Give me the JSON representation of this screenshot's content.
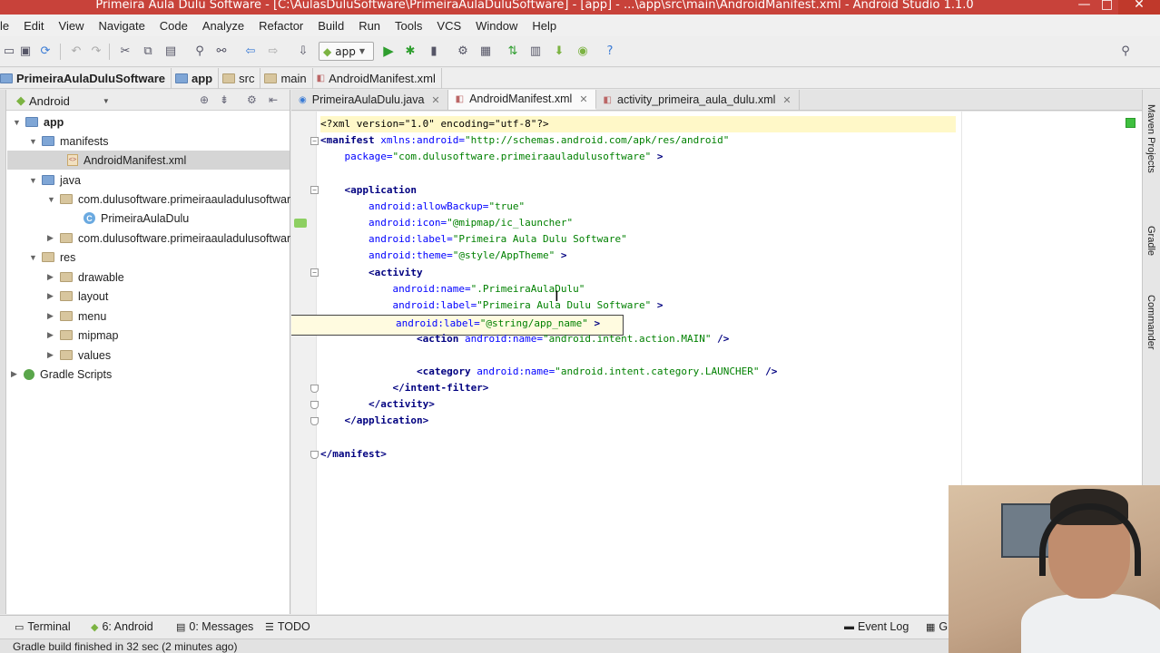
{
  "window": {
    "title": "Primeira Aula Dulu Software - [C:\\AulasDuluSoftware\\PrimeiraAulaDuluSoftware] - [app] - ...\\app\\src\\main\\AndroidManifest.xml - Android Studio 1.1.0",
    "minimize": "—",
    "maximize": "□",
    "close": "✕"
  },
  "menu": [
    "le",
    "Edit",
    "View",
    "Navigate",
    "Code",
    "Analyze",
    "Refactor",
    "Build",
    "Run",
    "Tools",
    "VCS",
    "Window",
    "Help"
  ],
  "toolbar": {
    "run_config": "app"
  },
  "breadcrumb": [
    "PrimeiraAulaDuluSoftware",
    "app",
    "src",
    "main",
    "AndroidManifest.xml"
  ],
  "project_pane": {
    "view_mode": "Android",
    "tree": [
      {
        "label": "app",
        "bold": true
      },
      {
        "label": "manifests"
      },
      {
        "label": "AndroidManifest.xml"
      },
      {
        "label": "java"
      },
      {
        "label": "com.dulusoftware.primeiraauladulusoftwar"
      },
      {
        "label": "PrimeiraAulaDulu"
      },
      {
        "label": "com.dulusoftware.primeiraauladulusoftwar"
      },
      {
        "label": "res"
      },
      {
        "label": "drawable"
      },
      {
        "label": "layout"
      },
      {
        "label": "menu"
      },
      {
        "label": "mipmap"
      },
      {
        "label": "values"
      },
      {
        "label": "Gradle Scripts"
      }
    ]
  },
  "editor_tabs": [
    {
      "label": "PrimeiraAulaDulu.java",
      "active": false
    },
    {
      "label": "AndroidManifest.xml",
      "active": true
    },
    {
      "label": "activity_primeira_aula_dulu.xml",
      "active": false
    }
  ],
  "code": {
    "l1": "<?xml version=\"1.0\" encoding=\"utf-8\"?>",
    "l2a": "<manifest ",
    "l2b": "xmlns:android=",
    "l2c": "\"http://schemas.android.com/apk/res/android\"",
    "l3a": "    package=",
    "l3b": "\"com.dulusoftware.primeiraauladulusoftware\"",
    "l3c": " >",
    "l5": "    <application",
    "l6a": "        android:allowBackup=",
    "l6b": "\"true\"",
    "l7a": "        android:icon=",
    "l7b": "\"@mipmap/ic_launcher\"",
    "l8a": "        android:label=",
    "l8b": "\"Primeira Aula Dulu Software\"",
    "l9a": "        android:theme=",
    "l9b": "\"@style/AppTheme\"",
    "l9c": " >",
    "l10": "        <activity",
    "l11a": "            android:name=",
    "l11b": "\".PrimeiraAulaDulu\"",
    "l12a": "            android:label=",
    "l12b": "\"Primeira Aula Dulu Software\"",
    "l12c": " >",
    "l13a": "android:label=",
    "l13b": "\"@string/app_name\"",
    "l13c": " >",
    "l14a": "                <action ",
    "l14b": "android:name=",
    "l14c": "\"android.intent.action.MAIN\"",
    "l14d": " />",
    "l16a": "                <category ",
    "l16b": "android:name=",
    "l16c": "\"android.intent.category.LAUNCHER\"",
    "l16d": " />",
    "l17": "            </intent-filter>",
    "l18": "        </activity>",
    "l19": "    </application>",
    "l21": "</manifest>"
  },
  "right_tools": [
    "Maven Projects",
    "Gradle",
    "Commander"
  ],
  "bottom_tools": [
    "Terminal",
    "6: Android",
    "0: Messages",
    "TODO",
    "Event Log",
    "G"
  ],
  "status": "Gradle build finished in 32 sec (2 minutes ago)",
  "colors": {
    "title_bar": "#c8423a",
    "xml_tag": "#000080",
    "xml_attr": "#0000ff",
    "xml_value": "#008000",
    "android_green": "#7cb342"
  }
}
